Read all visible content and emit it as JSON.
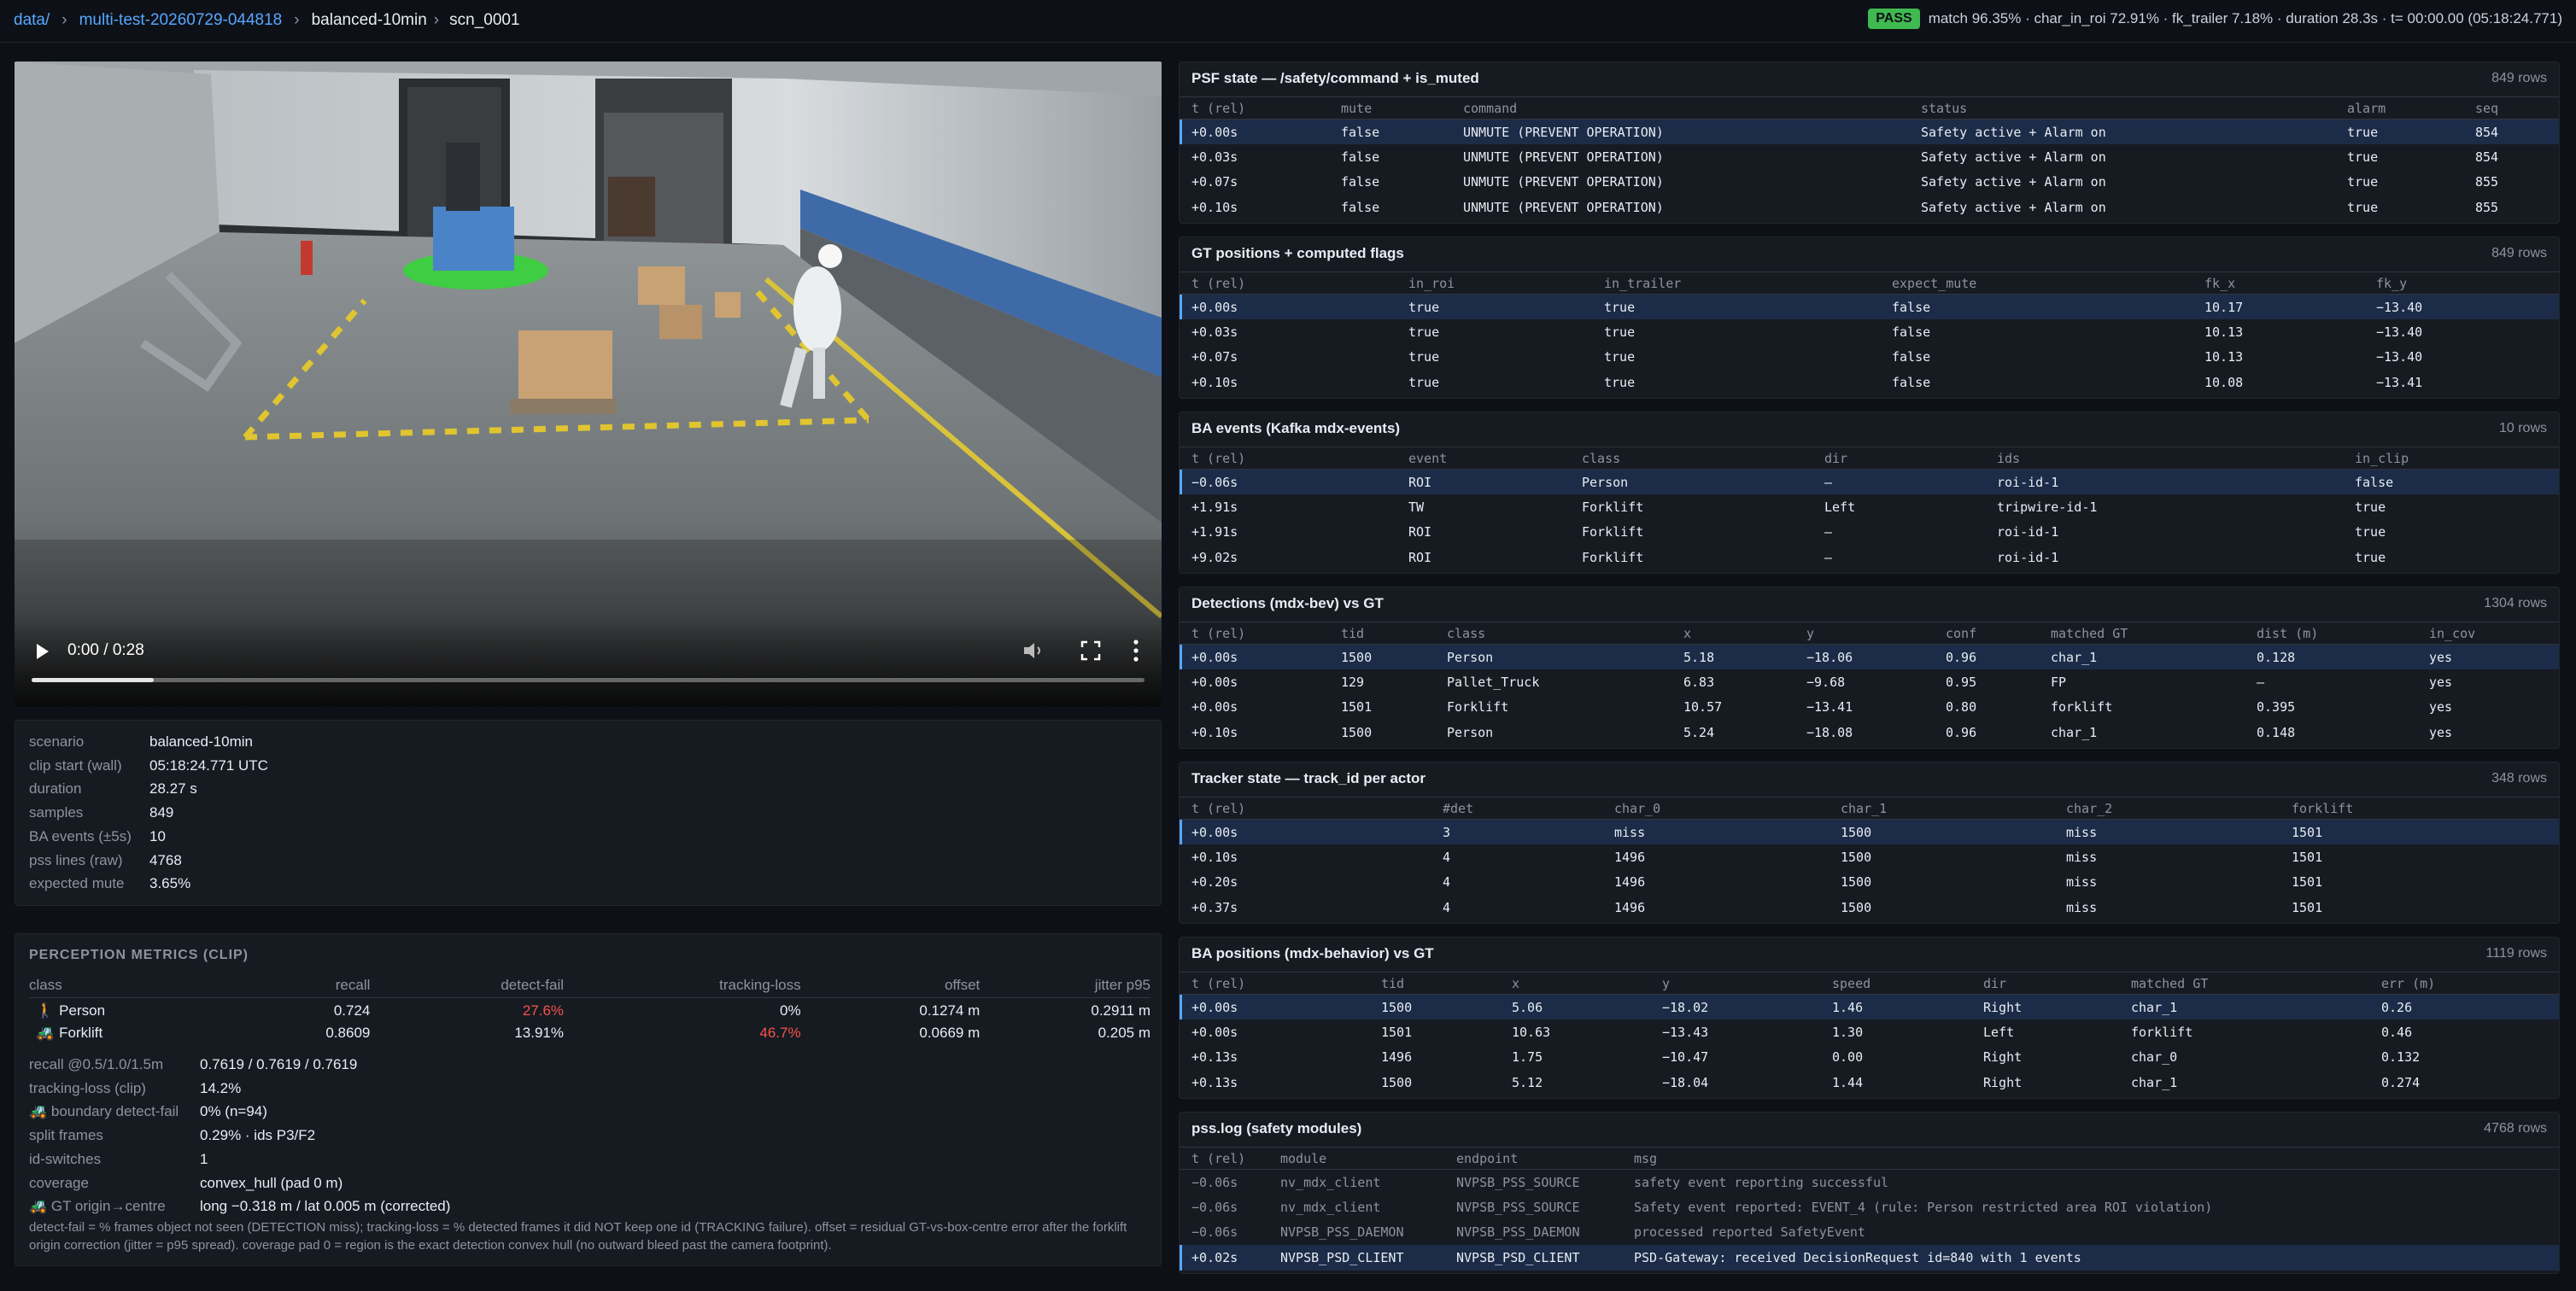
{
  "breadcrumb": {
    "root": "data/",
    "run": "multi-test-20260729-044818",
    "config": "balanced-10min",
    "scenario": "scn_0001"
  },
  "status": {
    "badge": "PASS",
    "summary": "match 96.35% · char_in_roi 72.91% · fk_trailer 7.18% · duration 28.3s · t= 00:00.00 (05:18:24.771)",
    "badge_color": "#3fb950"
  },
  "video": {
    "time": "0:00 / 0:28",
    "progress_fraction": 0.11
  },
  "info": [
    {
      "k": "scenario",
      "v": "balanced-10min"
    },
    {
      "k": "clip start (wall)",
      "v": "05:18:24.771 UTC"
    },
    {
      "k": "duration",
      "v": "28.27 s"
    },
    {
      "k": "samples",
      "v": "849"
    },
    {
      "k": "BA events (±5s)",
      "v": "10"
    },
    {
      "k": "pss lines (raw)",
      "v": "4768"
    },
    {
      "k": "expected mute",
      "v": "3.65%"
    }
  ],
  "perception": {
    "title": "PERCEPTION METRICS (CLIP)",
    "headers": [
      "class",
      "recall",
      "detect-fail",
      "tracking-loss",
      "offset",
      "jitter p95"
    ],
    "rows": [
      {
        "icon": "🚶",
        "class": "Person",
        "recall": "0.724",
        "detect_fail": "27.6%",
        "tracking_loss": "0%",
        "offset": "0.1274 m",
        "jitter": "0.2911 m"
      },
      {
        "icon": "🚜",
        "class": "Forklift",
        "recall": "0.8609",
        "detect_fail": "13.91%",
        "tracking_loss": "46.7%",
        "offset": "0.0669 m",
        "jitter": "0.205 m"
      }
    ],
    "kv": [
      {
        "k": "recall @0.5/1.0/1.5m",
        "v": "0.7619 / 0.7619 / 0.7619"
      },
      {
        "k": "tracking-loss (clip)",
        "v": "14.2%"
      },
      {
        "k": "🚜 boundary detect-fail",
        "v": "0% (n=94)"
      },
      {
        "k": "split frames",
        "v": "0.29% · ids P3/F2"
      },
      {
        "k": "id-switches",
        "v": "1"
      },
      {
        "k": "coverage",
        "v": "convex_hull (pad 0 m)"
      },
      {
        "k": "🚜 GT origin→centre",
        "v": "long −0.318 m / lat 0.005 m (corrected)"
      }
    ],
    "note": "detect-fail = % frames object not seen (DETECTION miss); tracking-loss = % detected frames it did NOT keep one id (TRACKING failure). offset = residual GT-vs-box-centre error after the forklift origin correction (jitter = p95 spread). coverage pad 0 = region is the exact detection convex hull (no outward bleed past the camera footprint)."
  },
  "panels": [
    {
      "title": "PSF state — /safety/command + is_muted",
      "count": "849 rows",
      "cols": [
        "t (rel)",
        "mute",
        "command",
        "status",
        "alarm",
        "seq"
      ],
      "rows": [
        [
          "+0.00s",
          "false",
          "UNMUTE (PREVENT OPERATION)",
          "Safety active + Alarm on",
          "true",
          "854"
        ],
        [
          "+0.03s",
          "false",
          "UNMUTE (PREVENT OPERATION)",
          "Safety active + Alarm on",
          "true",
          "854"
        ],
        [
          "+0.07s",
          "false",
          "UNMUTE (PREVENT OPERATION)",
          "Safety active + Alarm on",
          "true",
          "855"
        ],
        [
          "+0.10s",
          "false",
          "UNMUTE (PREVENT OPERATION)",
          "Safety active + Alarm on",
          "true",
          "855"
        ]
      ]
    },
    {
      "title": "GT positions + computed flags",
      "count": "849 rows",
      "cols": [
        "t (rel)",
        "in_roi",
        "in_trailer",
        "expect_mute",
        "fk_x",
        "fk_y"
      ],
      "rows": [
        [
          "+0.00s",
          "true",
          "true",
          "false",
          "10.17",
          "−13.40"
        ],
        [
          "+0.03s",
          "true",
          "true",
          "false",
          "10.13",
          "−13.40"
        ],
        [
          "+0.07s",
          "true",
          "true",
          "false",
          "10.13",
          "−13.40"
        ],
        [
          "+0.10s",
          "true",
          "true",
          "false",
          "10.08",
          "−13.41"
        ]
      ]
    },
    {
      "title": "BA events (Kafka mdx-events)",
      "count": "10 rows",
      "cols": [
        "t (rel)",
        "event",
        "class",
        "dir",
        "ids",
        "in_clip"
      ],
      "rows": [
        [
          "−0.06s",
          "ROI",
          "Person",
          "—",
          "roi-id-1",
          "false"
        ],
        [
          "+1.91s",
          "TW",
          "Forklift",
          "Left",
          "tripwire-id-1",
          "true"
        ],
        [
          "+1.91s",
          "ROI",
          "Forklift",
          "—",
          "roi-id-1",
          "true"
        ],
        [
          "+9.02s",
          "ROI",
          "Forklift",
          "—",
          "roi-id-1",
          "true"
        ]
      ]
    },
    {
      "title": "Detections (mdx-bev) vs GT",
      "count": "1304 rows",
      "cols": [
        "t (rel)",
        "tid",
        "class",
        "x",
        "y",
        "conf",
        "matched GT",
        "dist (m)",
        "in_cov"
      ],
      "rows": [
        [
          "+0.00s",
          "1500",
          "Person",
          "5.18",
          "−18.06",
          "0.96",
          "char_1",
          "0.128",
          "yes"
        ],
        [
          "+0.00s",
          "129",
          "Pallet_Truck",
          "6.83",
          "−9.68",
          "0.95",
          "FP",
          "—",
          "yes"
        ],
        [
          "+0.00s",
          "1501",
          "Forklift",
          "10.57",
          "−13.41",
          "0.80",
          "forklift",
          "0.395",
          "yes"
        ],
        [
          "+0.10s",
          "1500",
          "Person",
          "5.24",
          "−18.08",
          "0.96",
          "char_1",
          "0.148",
          "yes"
        ]
      ]
    },
    {
      "title": "Tracker state — track_id per actor",
      "count": "348 rows",
      "cols": [
        "t (rel)",
        "#det",
        "char_0",
        "char_1",
        "char_2",
        "forklift"
      ],
      "rows": [
        [
          "+0.00s",
          "3",
          "miss",
          "1500",
          "miss",
          "1501"
        ],
        [
          "+0.10s",
          "4",
          "1496",
          "1500",
          "miss",
          "1501"
        ],
        [
          "+0.20s",
          "4",
          "1496",
          "1500",
          "miss",
          "1501"
        ],
        [
          "+0.37s",
          "4",
          "1496",
          "1500",
          "miss",
          "1501"
        ]
      ]
    },
    {
      "title": "BA positions (mdx-behavior) vs GT",
      "count": "1119 rows",
      "cols": [
        "t (rel)",
        "tid",
        "x",
        "y",
        "speed",
        "dir",
        "matched GT",
        "err (m)"
      ],
      "rows": [
        [
          "+0.00s",
          "1500",
          "5.06",
          "−18.02",
          "1.46",
          "Right",
          "char_1",
          "0.26"
        ],
        [
          "+0.00s",
          "1501",
          "10.63",
          "−13.43",
          "1.30",
          "Left",
          "forklift",
          "0.46"
        ],
        [
          "+0.13s",
          "1496",
          "1.75",
          "−10.47",
          "0.00",
          "Right",
          "char_0",
          "0.132"
        ],
        [
          "+0.13s",
          "1500",
          "5.12",
          "−18.04",
          "1.44",
          "Right",
          "char_1",
          "0.274"
        ]
      ]
    },
    {
      "title": "pss.log (safety modules)",
      "count": "4768 rows",
      "cols": [
        "t (rel)",
        "module",
        "endpoint",
        "msg"
      ],
      "rows": [
        [
          "−0.06s",
          "nv_mdx_client",
          "NVPSB_PSS_SOURCE",
          "safety event reporting successful"
        ],
        [
          "−0.06s",
          "nv_mdx_client",
          "NVPSB_PSS_SOURCE",
          "Safety event reported: EVENT_4 (rule: Person restricted area ROI violation)"
        ],
        [
          "−0.06s",
          "NVPSB_PSS_DAEMON",
          "NVPSB_PSS_DAEMON",
          "processed reported SafetyEvent"
        ],
        [
          "+0.02s",
          "NVPSB_PSD_CLIENT",
          "NVPSB_PSD_CLIENT",
          "PSD-Gateway: received DecisionRequest id=840 with 1 events"
        ]
      ]
    }
  ]
}
